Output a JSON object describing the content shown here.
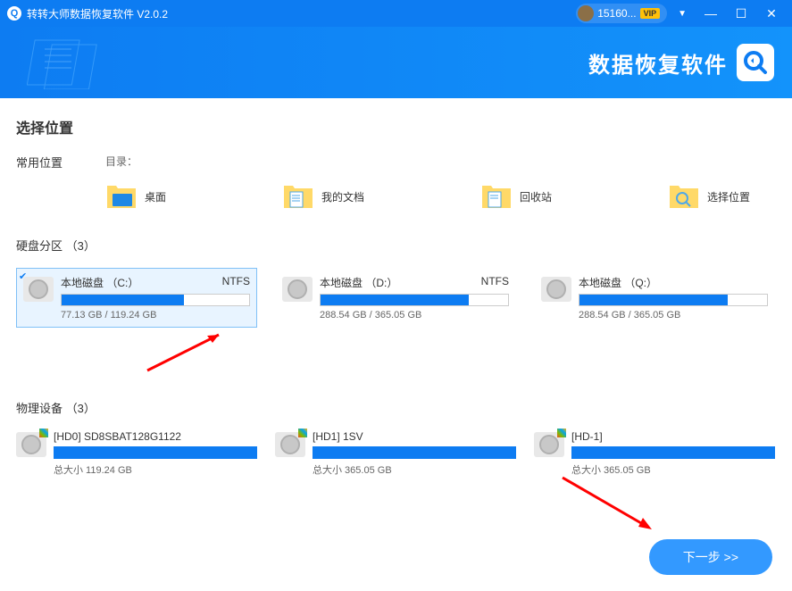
{
  "titlebar": {
    "app_name": "转转大师数据恢复软件 V2.0.2",
    "user_id": "15160...",
    "vip_label": "VIP"
  },
  "banner": {
    "title": "数据恢复软件"
  },
  "section": {
    "select_location": "选择位置",
    "common_location": "常用位置",
    "directory": "目录：",
    "partitions_title": "硬盘分区 （3）",
    "devices_title": "物理设备 （3）"
  },
  "common_locations": [
    {
      "label": "桌面"
    },
    {
      "label": "我的文档"
    },
    {
      "label": "回收站"
    },
    {
      "label": "选择位置"
    }
  ],
  "partitions": [
    {
      "name": "本地磁盘 （C:）",
      "fs": "NTFS",
      "used_pct": 65,
      "size": "77.13 GB / 119.24 GB",
      "selected": true
    },
    {
      "name": "本地磁盘 （D:）",
      "fs": "NTFS",
      "used_pct": 79,
      "size": "288.54 GB / 365.05 GB",
      "selected": false
    },
    {
      "name": "本地磁盘 （Q:）",
      "fs": "",
      "used_pct": 79,
      "size": "288.54 GB / 365.05 GB",
      "selected": false
    }
  ],
  "devices": [
    {
      "name": "[HD0] SD8SBAT128G1122",
      "size": "总大小 119.24 GB"
    },
    {
      "name": "[HD1] 1SV",
      "size": "总大小 365.05 GB"
    },
    {
      "name": "[HD-1]",
      "size": "总大小 365.05 GB"
    }
  ],
  "buttons": {
    "next": "下一步 >>"
  }
}
